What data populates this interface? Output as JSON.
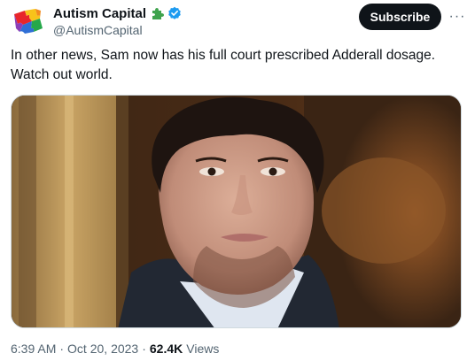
{
  "author": {
    "display_name": "Autism Capital",
    "handle": "@AutismCapital",
    "badge_icons": [
      "puzzle-piece-icon",
      "verified-icon"
    ],
    "verified_color": "#1d9bf0"
  },
  "actions": {
    "subscribe_label": "Subscribe",
    "more_label": "···"
  },
  "tweet": {
    "text_line1": "In other news, Sam now has his full court prescribed Adderall dosage.",
    "text_line2": "Watch out world."
  },
  "media": {
    "type": "photo"
  },
  "meta": {
    "time": "6:39 AM",
    "separator": "·",
    "date": "Oct 20, 2023",
    "views_count": "62.4K",
    "views_label": "Views"
  }
}
